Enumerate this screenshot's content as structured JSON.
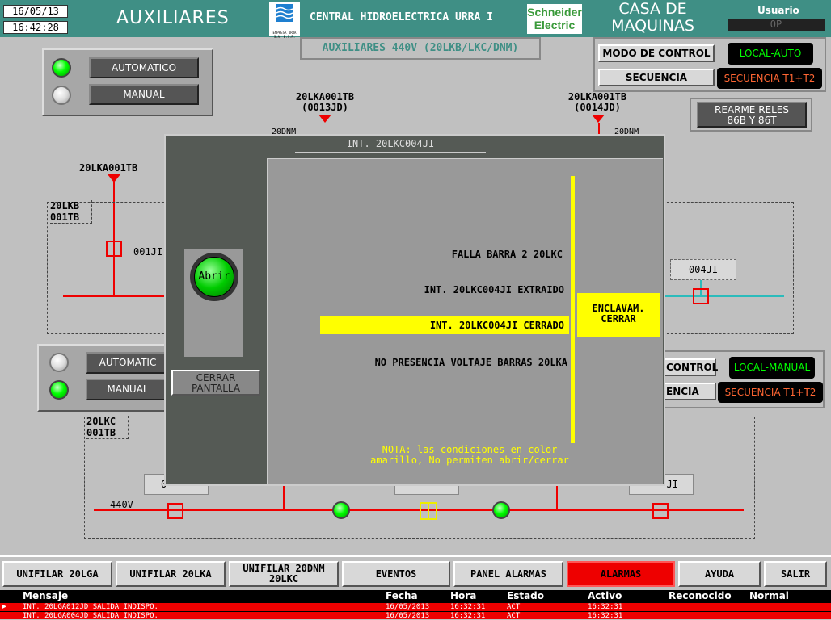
{
  "header": {
    "date": "16/05/13",
    "time": "16:42:28",
    "screen_title": "AUXILIARES",
    "company_logo_text": "EMPRESA URRA S.A. E.S.P.",
    "central_title": "CENTRAL HIDROELECTRICA URRA I",
    "schneider_logo": "Schneider Electric",
    "area_title_line1": "CASA DE",
    "area_title_line2": "MAQUINAS",
    "user_label": "Usuario",
    "user_value": "OP",
    "subtitle": "AUXILIARES 440V (20LKB/LKC/DNM)"
  },
  "control_top": {
    "modo_label": "MODO DE CONTROL",
    "modo_value": "LOCAL-AUTO",
    "secuencia_label": "SECUENCIA",
    "secuencia_value": "SECUENCIA T1+T2"
  },
  "control_mid": {
    "modo_label": "CONTROL",
    "modo_value": "LOCAL-MANUAL",
    "secuencia_label": "ENCIA",
    "secuencia_value": "SECUENCIA T1+T2"
  },
  "rearme": {
    "line1": "REARME RELES",
    "line2": "86B Y 86T"
  },
  "mode_panel_top": {
    "auto": "AUTOMATICO",
    "manual": "MANUAL"
  },
  "mode_panel_mid": {
    "auto": "AUTOMATIC",
    "manual": "MANUAL"
  },
  "diagram": {
    "feeder_left": "20LKA001TB",
    "feeder_mid_line1": "20LKA001TB",
    "feeder_mid_line2": "(0013JD)",
    "feeder_right_line1": "20LKA001TB",
    "feeder_right_line2": "(0014JD)",
    "partial_left": "20DNM",
    "partial_right": "20DNM",
    "box_lkb_line1": "20LKB",
    "box_lkb_line2": "001TB",
    "box_lkc_line1": "20LKC",
    "box_lkc_line2": "001TB",
    "breaker_001": "001JI",
    "breaker_004": "004JI",
    "lower_tag_left": "0",
    "lower_tag_right": "JI",
    "voltage": "440V"
  },
  "dialog": {
    "title": "INT. 20LKC004JI",
    "open_button": "Abrir",
    "close_screen_line1": "CERRAR",
    "close_screen_line2": "PANTALLA",
    "conditions": [
      "FALLA BARRA 2 20LKC",
      "INT. 20LKC004JI EXTRAIDO",
      "INT. 20LKC004JI CERRADO",
      "NO PRESENCIA VOLTAJE BARRAS 20LKA"
    ],
    "active_condition_index": 2,
    "interlock_line1": "ENCLAVAM.",
    "interlock_line2": "CERRAR",
    "note_line1": "NOTA: las condiciones en color",
    "note_line2": "amarillo, No permiten abrir/cerrar"
  },
  "bottom_nav": [
    {
      "label": "UNIFILAR 20LGA"
    },
    {
      "label": "UNIFILAR 20LKA"
    },
    {
      "label_line1": "UNIFILAR 20DNM",
      "label_line2": "20LKC"
    },
    {
      "label": "EVENTOS"
    },
    {
      "label": "PANEL ALARMAS"
    },
    {
      "label": "ALARMAS"
    },
    {
      "label": "AYUDA"
    },
    {
      "label": "SALIR"
    }
  ],
  "alarm_table": {
    "headers": [
      "Mensaje",
      "Fecha",
      "Hora",
      "Estado",
      "Activo",
      "Reconocido",
      "Normal"
    ],
    "rows": [
      [
        "INT. 20LGA012JD SALIDA INDISPO.",
        "16/05/2013",
        "16:32:31",
        "ACT",
        "16:32:31",
        "",
        ""
      ],
      [
        "INT. 20LGA004JD SALIDA INDISPO.",
        "16/05/2013",
        "16:32:31",
        "ACT",
        "16:32:31",
        "",
        ""
      ]
    ]
  },
  "colors": {
    "header_teal": "#3f8f85",
    "lamp_green": "#00ff00",
    "alarm_red": "#ee0000",
    "condition_yellow": "#ffff00",
    "local_green": "#00ff00",
    "sequence_orange": "#ff6633"
  }
}
